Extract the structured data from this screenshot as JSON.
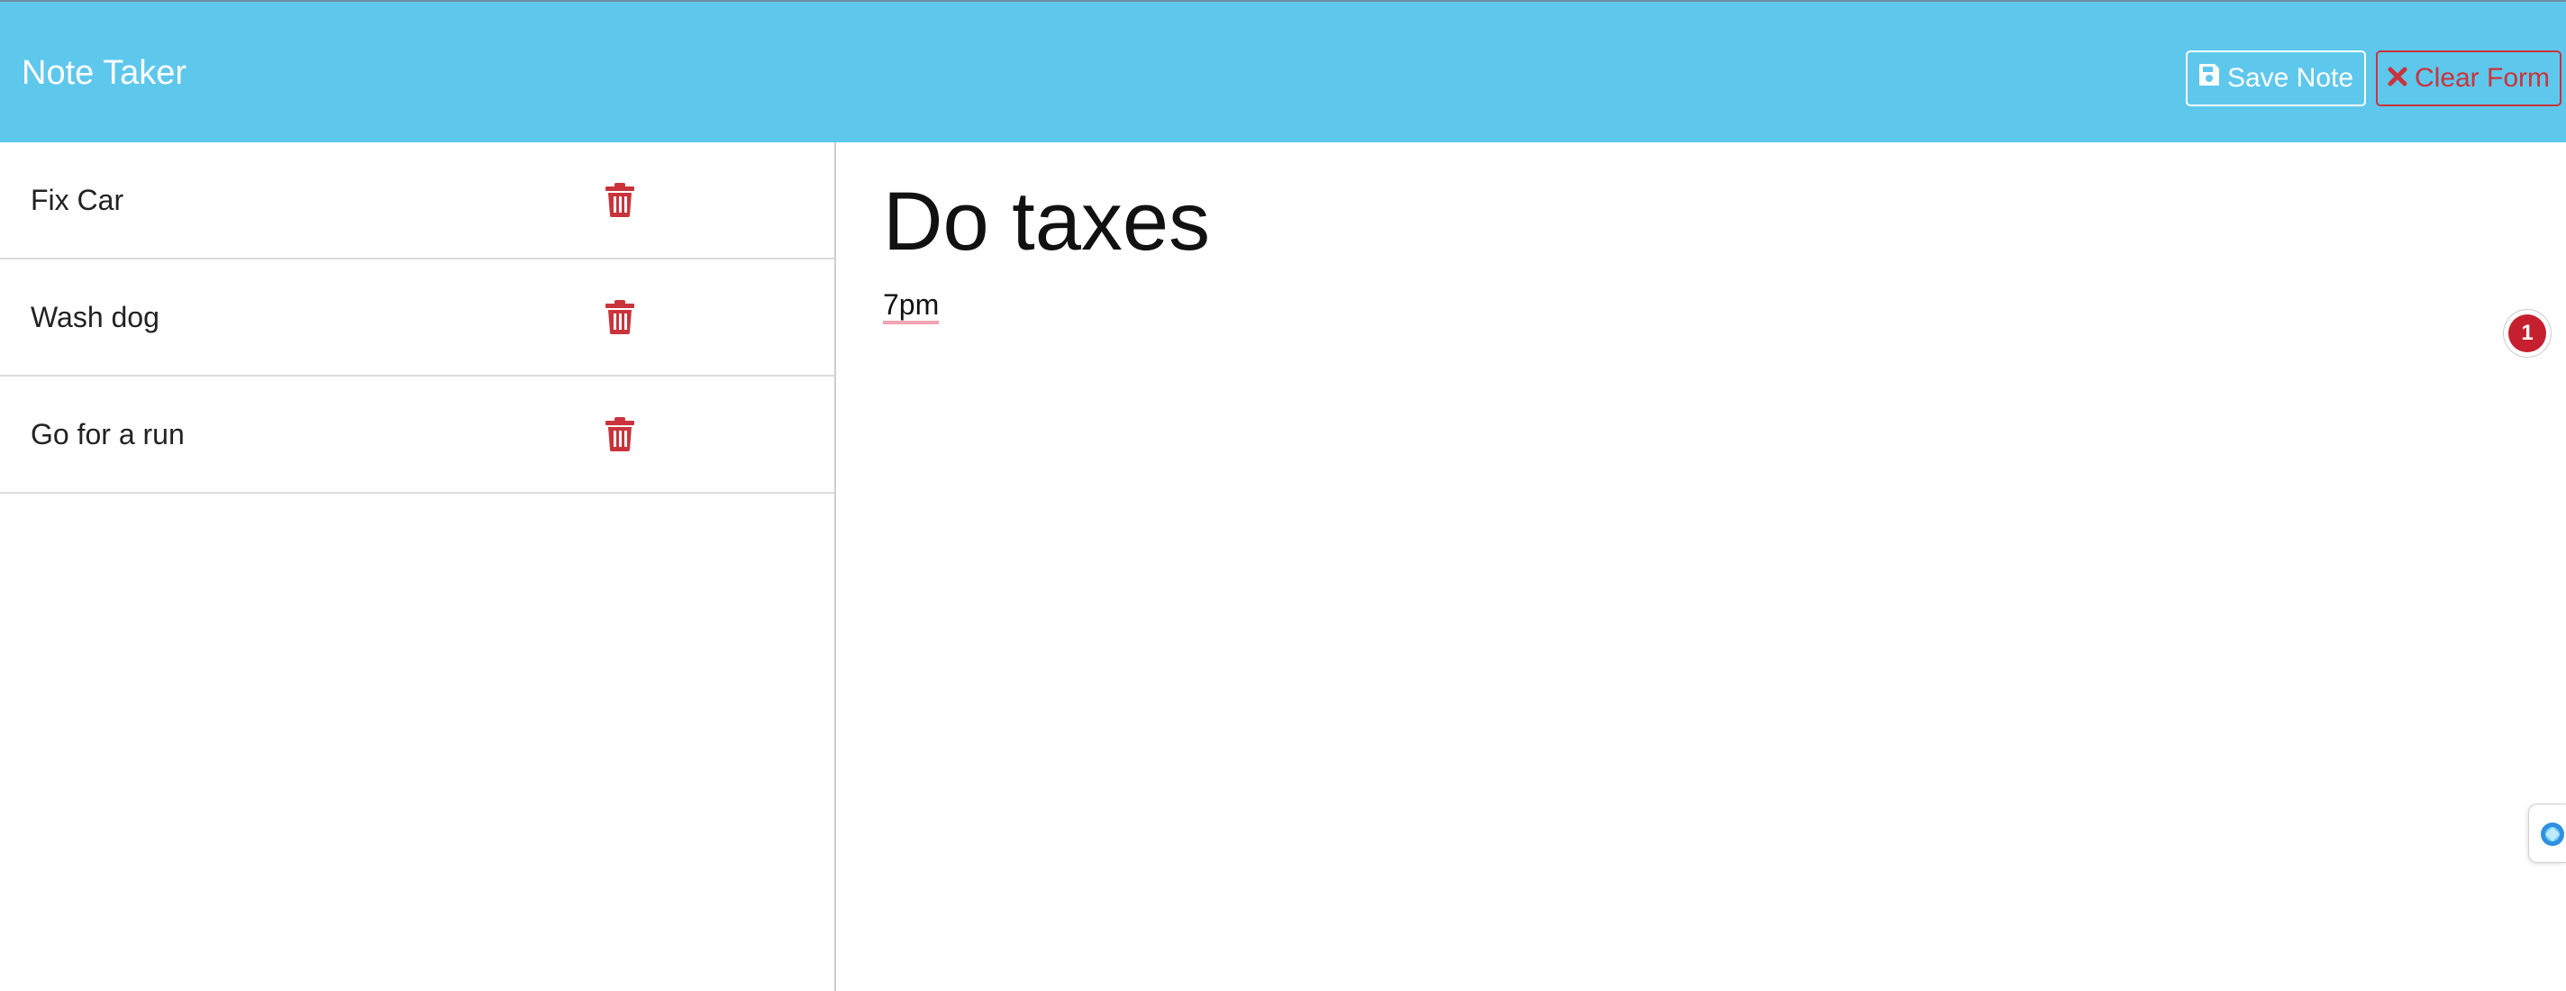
{
  "header": {
    "brand": "Note Taker",
    "save_label": "Save Note",
    "clear_label": "Clear Form"
  },
  "notes": [
    {
      "title": "Fix Car"
    },
    {
      "title": "Wash dog"
    },
    {
      "title": "Go for a run"
    }
  ],
  "active_note": {
    "title": "Do taxes",
    "text": "7pm"
  },
  "notification_badge": {
    "count": "1"
  },
  "colors": {
    "navbar": "#5ec7ec",
    "danger": "#c9343c",
    "badge": "#c5202f"
  },
  "icons": {
    "save": "floppy-disk-icon",
    "clear": "x-icon",
    "delete": "trash-icon",
    "extension": "extension-icon"
  }
}
